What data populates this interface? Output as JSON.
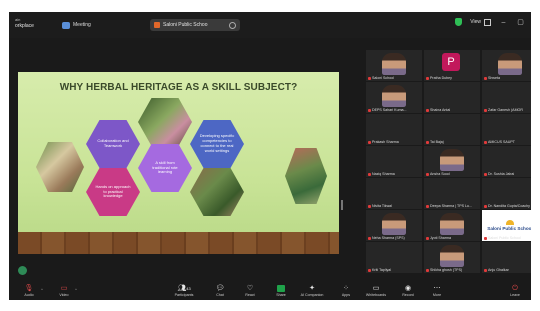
{
  "titlebar": {
    "brand_line1": "ain",
    "brand_line2": "orkplace",
    "meeting_label": "Meeting",
    "share_label": "Saloni Public Schoo",
    "view_label": "View"
  },
  "slide": {
    "title": "WHY HERBAL HERITAGE AS A SKILL SUBJECT?",
    "hex_collab": "Collaboration and Teamwork",
    "hex_develop": "Developing specific competencies to connect to the real world settings",
    "hex_skill": "A skill from traditional rote learning",
    "hex_hands": "Hands on approach to practical knowledge"
  },
  "participants": [
    {
      "name": "Saloni School",
      "kind": "video"
    },
    {
      "name": "Pratha Dubey",
      "kind": "avatar",
      "letter": "P"
    },
    {
      "name": "Shweta",
      "kind": "video"
    },
    {
      "name": "DEPS Sahari Kuma...",
      "kind": "video"
    },
    {
      "name": "Shaina Antal",
      "kind": "name"
    },
    {
      "name": "Zafar Ganesh (AMOR",
      "kind": "name"
    },
    {
      "name": "Prakash Sharma",
      "kind": "name"
    },
    {
      "name": "Tai Bajaj",
      "kind": "name"
    },
    {
      "name": "AMICUS SAUPT",
      "kind": "name"
    },
    {
      "name": "Naziq Sharma",
      "kind": "name"
    },
    {
      "name": "Ansha Sood",
      "kind": "video"
    },
    {
      "name": "Dr. Sushia Jalrai",
      "kind": "name"
    },
    {
      "name": "Nivita Tikwal",
      "kind": "name"
    },
    {
      "name": "Deepa Sharma | TPS Lu...",
      "kind": "name"
    },
    {
      "name": "Dr. Nandita Gupta/Coachy S...",
      "kind": "name"
    },
    {
      "name": "Neha Sharma (SPS)",
      "kind": "video"
    },
    {
      "name": "Jyoti Sharma",
      "kind": "video"
    },
    {
      "name": "Saloni Public School",
      "kind": "logo"
    },
    {
      "name": "Kriti Tapliyal",
      "kind": "name"
    },
    {
      "name": "Shikha ghosh (TPS)",
      "kind": "video"
    },
    {
      "name": "Anju Ghalkar",
      "kind": "name"
    }
  ],
  "toolbar": {
    "audio": "Audio",
    "video": "Video",
    "participants": "Participants",
    "participants_count": "43",
    "chat": "Chat",
    "react": "React",
    "share": "Share",
    "ai": "AI Companion",
    "apps": "Apps",
    "whiteboards": "Whiteboards",
    "record": "Record",
    "more": "More",
    "leave": "Leave"
  }
}
